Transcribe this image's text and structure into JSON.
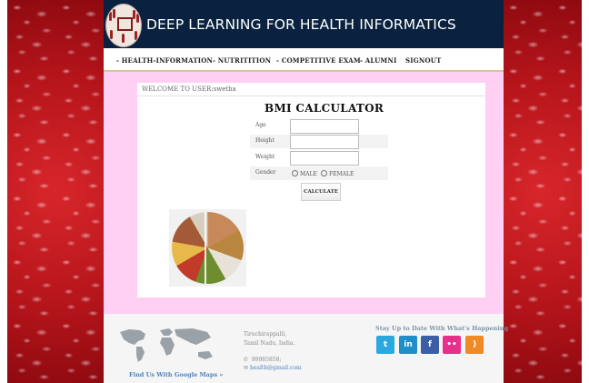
{
  "header": {
    "title": "DEEP LEARNING FOR HEALTH INFORMATICS"
  },
  "nav": {
    "items": [
      {
        "label": "- HEALTH-INFORMATION"
      },
      {
        "label": "- NUTRITITION"
      },
      {
        "label": "- COMPETITIVE EXAM"
      },
      {
        "label": "- ALUMNI"
      },
      {
        "label": "SIGNOUT"
      }
    ]
  },
  "welcome": "WELCOME TO USER:swetha",
  "bmi": {
    "title": "BMI CALCULATOR",
    "age_label": "Age",
    "age_value": "",
    "height_label": "Height",
    "height_value": "",
    "weight_label": "Weight",
    "weight_value": "",
    "gender_label": "Gender",
    "male_label": "MALE",
    "female_label": "FEMALE",
    "calculate_label": "CALCULATE"
  },
  "footer": {
    "map_link": "Find Us With Google Maps »",
    "address_line1": "Tiruchirappalli,",
    "address_line2": "Tamil Nadu, India.",
    "phone": "99985858;",
    "email": "health@gmail.com",
    "stay_text": "Stay Up to Date With What's Happening",
    "social": [
      {
        "icon": "twitter-icon",
        "glyph": "t",
        "color": "#2aa9e0"
      },
      {
        "icon": "linkedin-icon",
        "glyph": "in",
        "color": "#1f8ec9"
      },
      {
        "icon": "facebook-icon",
        "glyph": "f",
        "color": "#3b5ea6"
      },
      {
        "icon": "flickr-icon",
        "glyph": "••",
        "color": "#e8308a"
      },
      {
        "icon": "rss-icon",
        "glyph": ")",
        "color": "#f08a27"
      }
    ]
  }
}
